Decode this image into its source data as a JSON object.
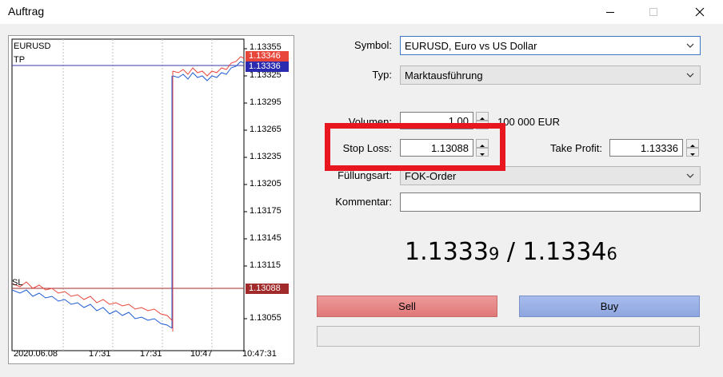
{
  "window": {
    "title": "Auftrag"
  },
  "chart": {
    "symbol": "EURUSD",
    "tp_label": "TP",
    "sl_label": "SL",
    "price_axis": [
      "1.13355",
      "1.13325",
      "1.13295",
      "1.13265",
      "1.13235",
      "1.13205",
      "1.13175",
      "1.13145",
      "1.13115",
      "1.13055"
    ],
    "ask_badge": "1.13346",
    "bid_badge": "1.13336",
    "sl_badge": "1.13088",
    "time_axis": [
      "2020.06.08",
      "17:31",
      "17:31",
      "10:47",
      "10:47:31"
    ],
    "colors": {
      "tp_line": "#3a3aa8",
      "sl_line": "#a12a2a",
      "ask": "#e8453b",
      "bid": "#1f5bd3"
    }
  },
  "form": {
    "symbol_label": "Symbol:",
    "symbol_value": "EURUSD, Euro vs US Dollar",
    "type_label": "Typ:",
    "type_value": "Marktausführung",
    "volume_label": "Volumen:",
    "volume_value": "1.00",
    "volume_units": "100 000 EUR",
    "sl_label": "Stop Loss:",
    "sl_value": "1.13088",
    "tp_label": "Take Profit:",
    "tp_value": "1.13336",
    "fill_label": "Füllungsart:",
    "fill_value": "FOK-Order",
    "comment_label": "Kommentar:",
    "comment_value": ""
  },
  "quote": {
    "bid_main": "1.1333",
    "bid_small": "9",
    "separator": " / ",
    "ask_main": "1.1334",
    "ask_small": "6"
  },
  "buttons": {
    "sell": "Sell",
    "buy": "Buy"
  },
  "highlight_color": "#e8171f"
}
